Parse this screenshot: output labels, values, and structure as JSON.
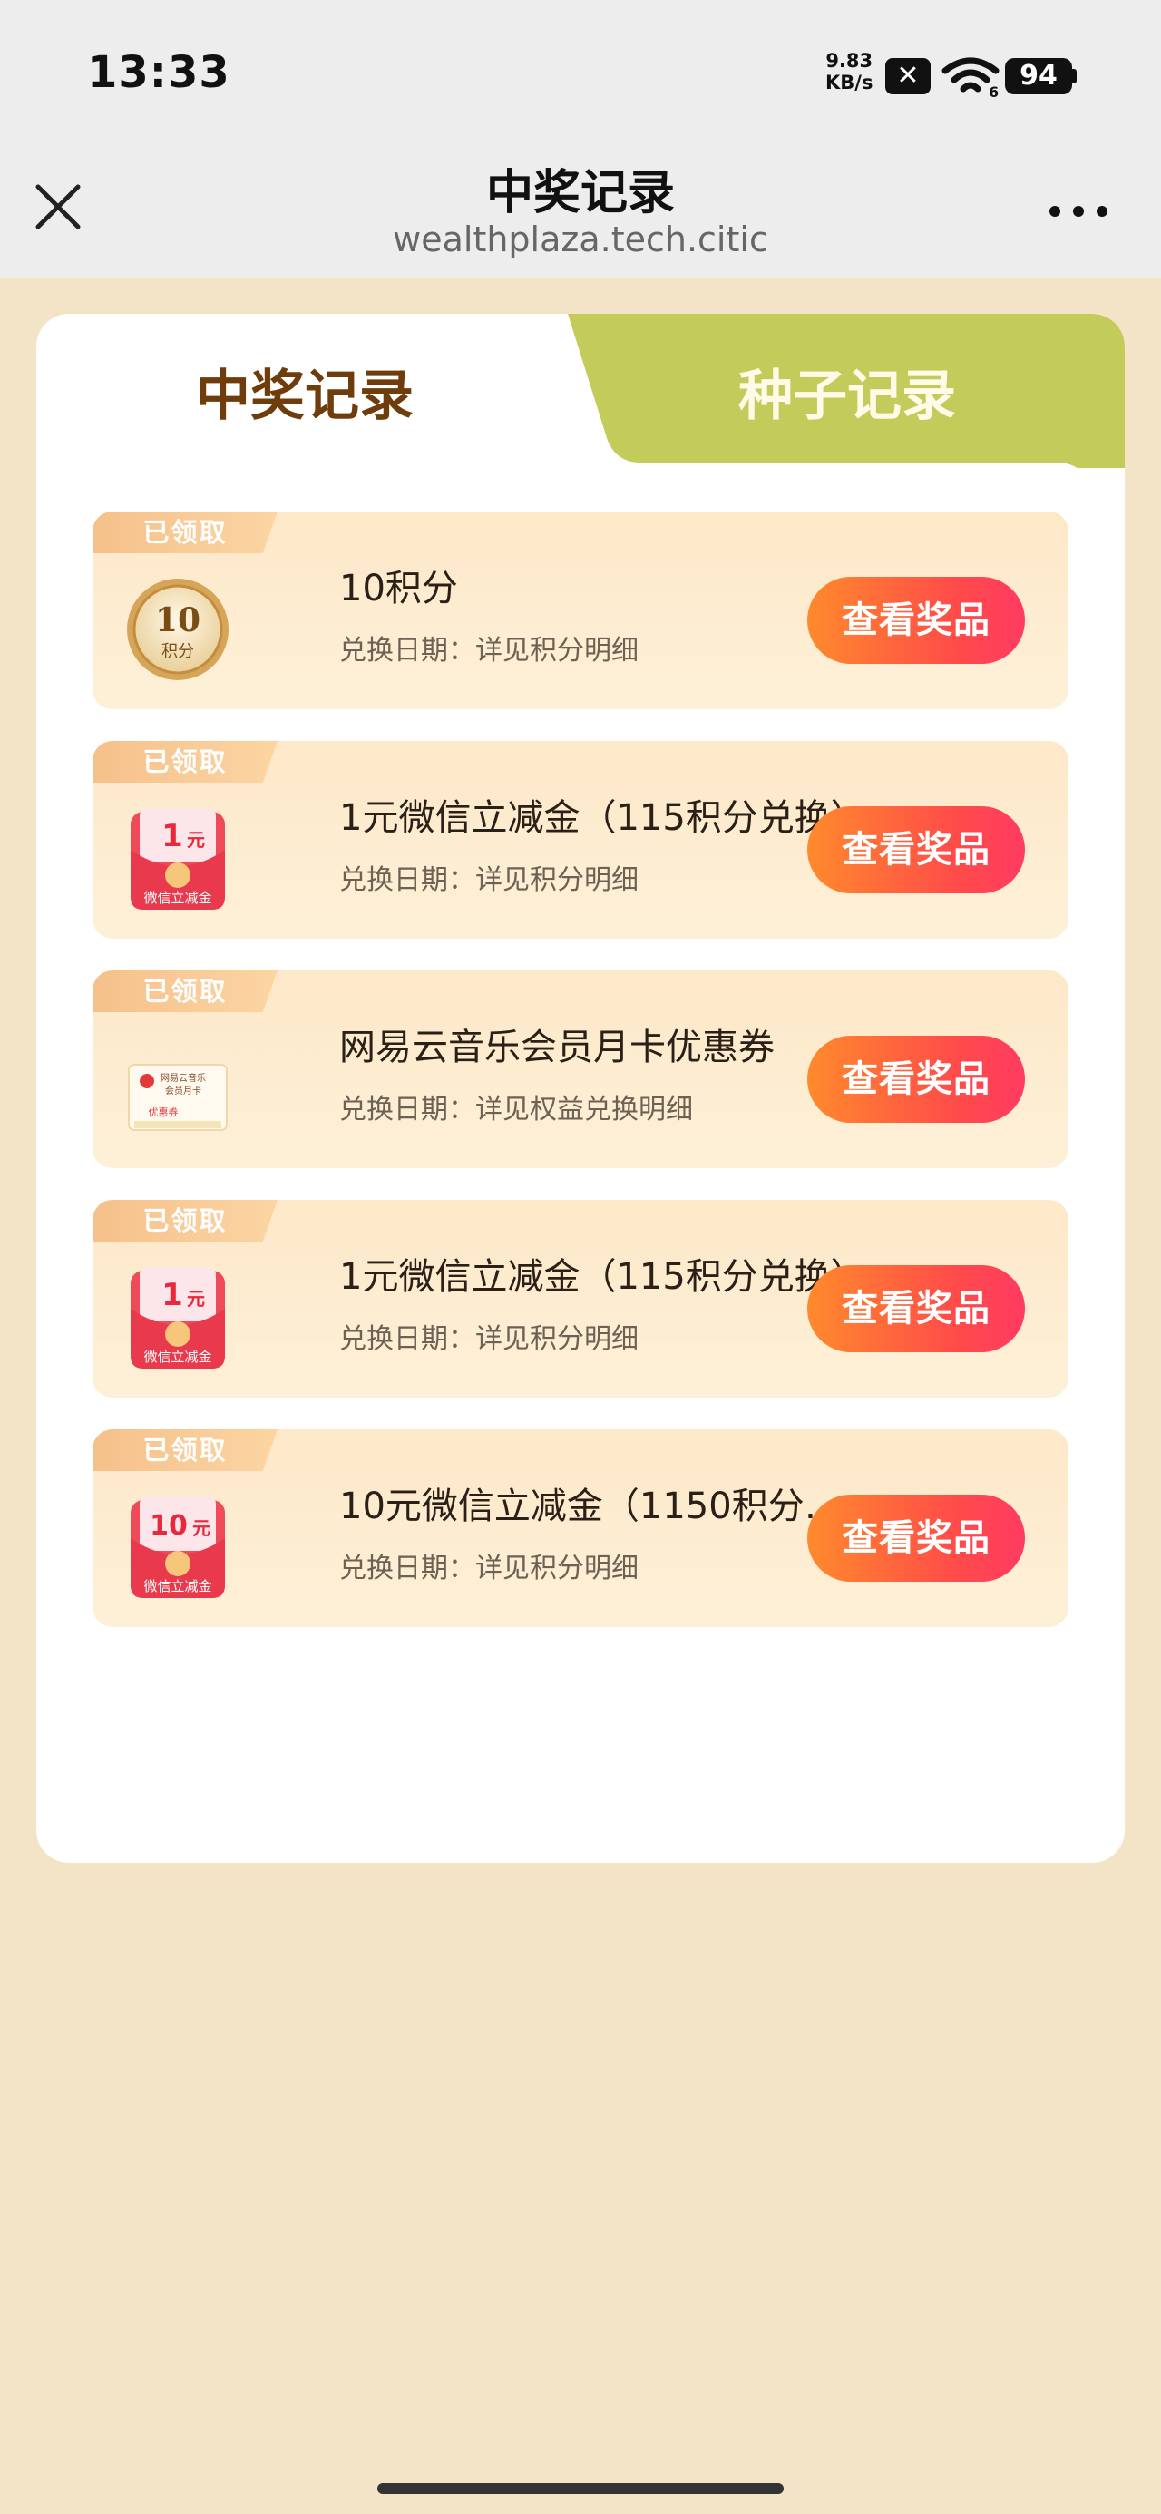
{
  "status_bar": {
    "time": "13:33",
    "net_speed_value": "9.83",
    "net_speed_unit": "KB/s",
    "wifi_badge": "6",
    "battery": "94"
  },
  "nav": {
    "title": "中奖记录",
    "url": "wealthplaza.tech.citic"
  },
  "tabs": [
    {
      "label": "中奖记录",
      "active": true
    },
    {
      "label": "种子记录",
      "active": false
    }
  ],
  "records": [
    {
      "badge": "已领取",
      "icon": "coin-10-points-icon",
      "icon_text": "10",
      "icon_sub": "积分",
      "title": "10积分",
      "subtitle": "兑换日期：详见积分明细",
      "button": "查看奖品"
    },
    {
      "badge": "已领取",
      "icon": "wechat-red-envelope-icon",
      "icon_text": "1",
      "icon_unit": "元",
      "icon_sub": "微信立减金",
      "title": "1元微信立减金（115积分兑换）",
      "subtitle": "兑换日期：详见积分明细",
      "button": "查看奖品"
    },
    {
      "badge": "已领取",
      "icon": "netease-music-coupon-icon",
      "icon_line1": "网易云音乐",
      "icon_line2": "会员月卡",
      "icon_sub": "优惠券",
      "title": "网易云音乐会员月卡优惠券",
      "subtitle": "兑换日期：详见权益兑换明细",
      "button": "查看奖品"
    },
    {
      "badge": "已领取",
      "icon": "wechat-red-envelope-icon",
      "icon_text": "1",
      "icon_unit": "元",
      "icon_sub": "微信立减金",
      "title": "1元微信立减金（115积分兑换）",
      "subtitle": "兑换日期：详见积分明细",
      "button": "查看奖品"
    },
    {
      "badge": "已领取",
      "icon": "wechat-red-envelope-icon",
      "icon_text": "10",
      "icon_unit": "元",
      "icon_sub": "微信立减金",
      "title": "10元微信立减金（1150积分兑…",
      "subtitle": "兑换日期：详见积分明细",
      "button": "查看奖品"
    }
  ],
  "colors": {
    "page_bg": "#f3e4c8",
    "active_tab_text": "#6e3d0b",
    "inactive_tab_bg": "#c3cb5a",
    "button_start": "#ff8a2c",
    "button_end": "#ff3b62"
  }
}
